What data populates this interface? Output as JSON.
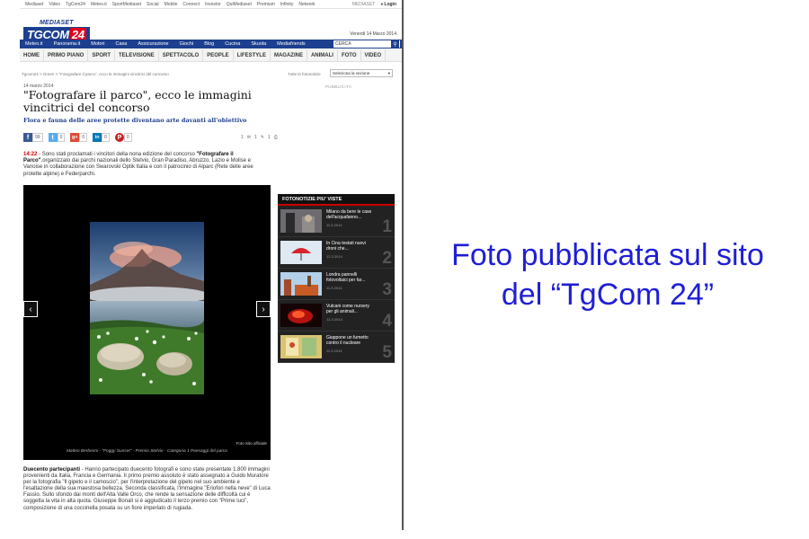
{
  "netbar": {
    "items": [
      "Mediaset",
      "Video",
      "TgCom24",
      "Meteo.it",
      "SportMediaset",
      "Social",
      "Mobile",
      "Connect",
      "Investor",
      "QuiMediaset",
      "Premium",
      "Infinity",
      "Network"
    ],
    "mediaset_label": "MEDIASET",
    "login_label": "Login"
  },
  "logo": {
    "mediaset": "MEDIASET",
    "tgcom": "TGCOM",
    "tgcom_num": "24"
  },
  "date": "Venerdi 14 Marzo 2014",
  "bluenav": {
    "items": [
      "Meteo.it",
      "Panorama.it",
      "Motori",
      "Casa",
      "Assicurazione",
      "Giochi",
      "Blog",
      "Cucina",
      "Skuola",
      "Mediafriends"
    ],
    "search_placeholder": "CERCA"
  },
  "secnav": [
    "HOME",
    "PRIMO PIANO",
    "SPORT",
    "TELEVISIONE",
    "SPETTACOLO",
    "PEOPLE",
    "LIFESTYLE",
    "MAGAZINE",
    "ANIMALI",
    "FOTO",
    "VIDEO"
  ],
  "breadcrumb": "Tgcom24 > Green > \"Fotografare il parco\", ecco le immagini vincitrici del concorso",
  "all_photos_label": "Tutte le fotonotizie",
  "section_select": "Seleziona la sezione",
  "ad_label": "PUBBLICITÀ",
  "article": {
    "date": "14 marzo 2014",
    "headline": "\"Fotografare il parco\", ecco le immagini vincitrici del concorso",
    "subhead": "Flora e fauna delle aree protette diventano arte davanti all'obiettivo",
    "time": "14:22",
    "lead_text_1": " - Sono stati proclamati i vincitori della nona edizione del concorso ",
    "lead_bold": "\"Fotografare il Parco\"",
    "lead_text_2": ",organizzato dai parchi nazionali dello Stelvio, Gran Paradiso, Abruzzo, Lazio e Molise e Vanoise in collaborazione con Swarovski Optik Italia e con il patrocinio di Alparc (Rete delle aree protette alpine) e Federparchi.",
    "body_bold": "Duecento partecipanti",
    "body_text": " - Hanno partecipato duecento fotografi e sono state presentate 1.800 immagini provenienti da Italia, Francia e Germania. Il primo premio assoluto è stato assegnato a Guido Muratore per la fotografia \"Il gipeto e il camoscio\", per l'interpretazione del gipeto nel suo ambiente e l'esaltazione della sua maestosa bellezza. Seconda classificata, l'immagine \"Eriofori nella neve\" di Luca Fassio. Sullo sfondo dai monti dell'Alta Valle Orco, che rende la sensazione delle difficoltà cui è soggetta la vita in alta quota. Giuseppe Bonali si è aggiudicato il terzo premio con \"Prime luci\", composizione di una coccinella posata su un fiore imperlato di rugiada."
  },
  "share": [
    {
      "icon": "f",
      "count": "99",
      "color": "#3b5998"
    },
    {
      "icon": "t",
      "count": "0",
      "color": "#55acee"
    },
    {
      "icon": "g+",
      "count": "0",
      "color": "#dd4b39"
    },
    {
      "icon": "in",
      "count": "0",
      "color": "#0077b5"
    },
    {
      "icon": "P",
      "count": "0",
      "color": "#cb2027"
    }
  ],
  "tools": [
    "1",
    "1",
    "1"
  ],
  "gallery": {
    "caption": "Matteo Berbenni - \"Foggy Sunset\" - Premio Stelvio - Categoria 1 Paesaggi del parco",
    "photo_site": "Foto Sito ufficiale"
  },
  "sidebar": {
    "title": "FOTONOTIZIE PIU' VISTE",
    "items": [
      {
        "title": "Milano da bere le case dell'acquafanno...",
        "date": "11.3.2014",
        "num": "1"
      },
      {
        "title": "In Cina testati nuovi droni che...",
        "date": "12.3.2014",
        "num": "2"
      },
      {
        "title": "Londra pannelli fotovoltaici per far...",
        "date": "11.3.2014",
        "num": "3"
      },
      {
        "title": "Vulcani come nursery per gli animali...",
        "date": "12.3.2014",
        "num": "4"
      },
      {
        "title": "Giappone un fumetto contro il nucleare",
        "date": "11.3.2014",
        "num": "5"
      }
    ]
  },
  "note": {
    "line1": "Foto pubblicata sul sito",
    "line2": "del “TgCom 24”"
  }
}
